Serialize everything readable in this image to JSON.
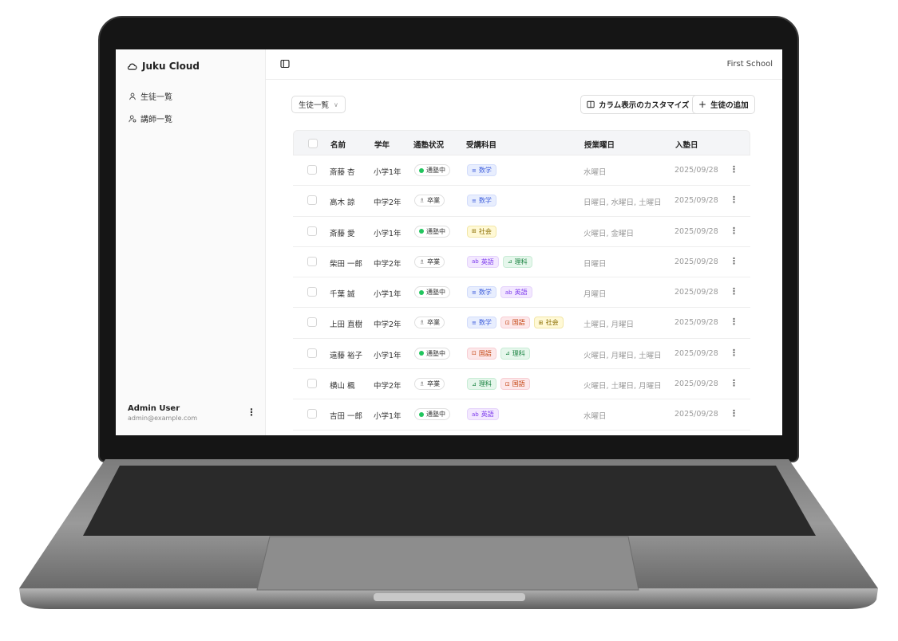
{
  "app": {
    "name": "Juku Cloud",
    "school": "First School"
  },
  "sidebar": {
    "items": [
      {
        "label": "生徒一覧",
        "icon": "user-icon"
      },
      {
        "label": "講師一覧",
        "icon": "user-cog-icon"
      }
    ],
    "user": {
      "name": "Admin User",
      "email": "admin@example.com"
    }
  },
  "toolbar": {
    "view_select": "生徒一覧",
    "column_button": "カラム表示のカスタマイズ",
    "add_button": "生徒の追加"
  },
  "table": {
    "headers": {
      "name": "名前",
      "grade": "学年",
      "status": "通塾状況",
      "subjects": "受講科目",
      "days": "授業曜日",
      "joined": "入塾日"
    },
    "rows": [
      {
        "name": "斎藤 杏",
        "grade": "小学1年",
        "status": "通塾中",
        "subjects": [
          "数学"
        ],
        "days": "水曜日",
        "joined": "2025/09/28"
      },
      {
        "name": "高木 諒",
        "grade": "中学2年",
        "status": "卒業",
        "subjects": [
          "数学"
        ],
        "days": "日曜日, 水曜日, 土曜日",
        "joined": "2025/09/28"
      },
      {
        "name": "斎藤 愛",
        "grade": "小学1年",
        "status": "通塾中",
        "subjects": [
          "社会"
        ],
        "days": "火曜日, 金曜日",
        "joined": "2025/09/28"
      },
      {
        "name": "柴田 一郎",
        "grade": "中学2年",
        "status": "卒業",
        "subjects": [
          "英語",
          "理科"
        ],
        "days": "日曜日",
        "joined": "2025/09/28"
      },
      {
        "name": "千葉 誠",
        "grade": "小学1年",
        "status": "通塾中",
        "subjects": [
          "数学",
          "英語"
        ],
        "days": "月曜日",
        "joined": "2025/09/28"
      },
      {
        "name": "上田 直樹",
        "grade": "中学2年",
        "status": "卒業",
        "subjects": [
          "数学",
          "国語",
          "社会"
        ],
        "days": "土曜日, 月曜日",
        "joined": "2025/09/28"
      },
      {
        "name": "遠藤 裕子",
        "grade": "小学1年",
        "status": "通塾中",
        "subjects": [
          "国語",
          "理科"
        ],
        "days": "火曜日, 月曜日, 土曜日",
        "joined": "2025/09/28"
      },
      {
        "name": "横山 楓",
        "grade": "中学2年",
        "status": "卒業",
        "subjects": [
          "理科",
          "国語"
        ],
        "days": "火曜日, 土曜日, 月曜日",
        "joined": "2025/09/28"
      },
      {
        "name": "吉田 一郎",
        "grade": "小学1年",
        "status": "通塾中",
        "subjects": [
          "英語"
        ],
        "days": "水曜日",
        "joined": "2025/09/28"
      }
    ]
  },
  "subject_styles": {
    "数学": {
      "bg": "#e8eefe",
      "fg": "#3b5bdb",
      "border": "#d3ddfb",
      "icon": "≡"
    },
    "社会": {
      "bg": "#fff9d6",
      "fg": "#8a6d00",
      "border": "#f2e7a8",
      "icon": "⊞"
    },
    "英語": {
      "bg": "#f3e8ff",
      "fg": "#7c3aed",
      "border": "#e5d4fb",
      "icon": "ab"
    },
    "理科": {
      "bg": "#e6f7ec",
      "fg": "#15803d",
      "border": "#c9ecd6",
      "icon": "⊿"
    },
    "国語": {
      "bg": "#fde8ea",
      "fg": "#c2410c",
      "border": "#f8cfd4",
      "icon": "⊡"
    }
  },
  "status_colors": {
    "active": "#22c55e"
  }
}
